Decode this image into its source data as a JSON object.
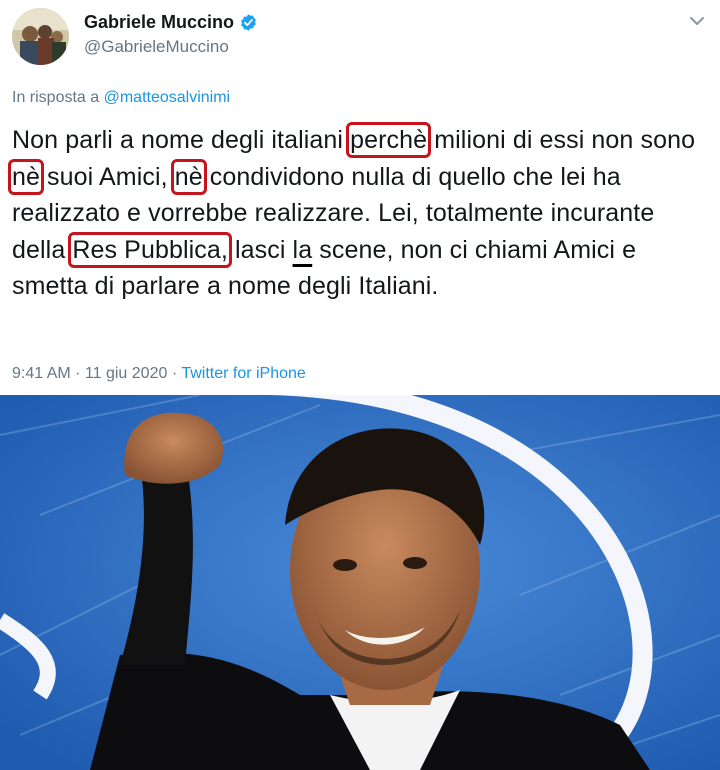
{
  "author": {
    "name": "Gabriele Muccino",
    "handle": "@GabrieleMuccino",
    "verified": true,
    "avatar_icon": "avatar-photo"
  },
  "menu_icon": "chevron-down-icon",
  "reply": {
    "prefix": "In risposta a",
    "mention": "@matteosalvinimi"
  },
  "text": {
    "s1": "Non parli a nome degli italiani ",
    "w1": "perchè",
    "s2": " milioni di essi non sono ",
    "w2": "nè",
    "s3": " suoi Amici, ",
    "w3": "nè",
    "s4": " condividono nulla di quello che lei ha realizzato e vorrebbe realizzare. Lei, totalmente incurante della ",
    "w4": "Res Pubblica,",
    "s5": " lasci ",
    "w5": "la",
    "s6": " scene, non ci chiami Amici e smetta di parlare a nome degli Italiani."
  },
  "meta": {
    "time": "9:41 AM",
    "separator1": " · ",
    "date": "11 giu 2020",
    "separator2": " · ",
    "source": "Twitter for iPhone"
  },
  "colors": {
    "highlight_box": "#c4151c",
    "link": "#1b95e0",
    "verified_badge": "#1da1f2",
    "photo_background": "#2f6fc8"
  }
}
